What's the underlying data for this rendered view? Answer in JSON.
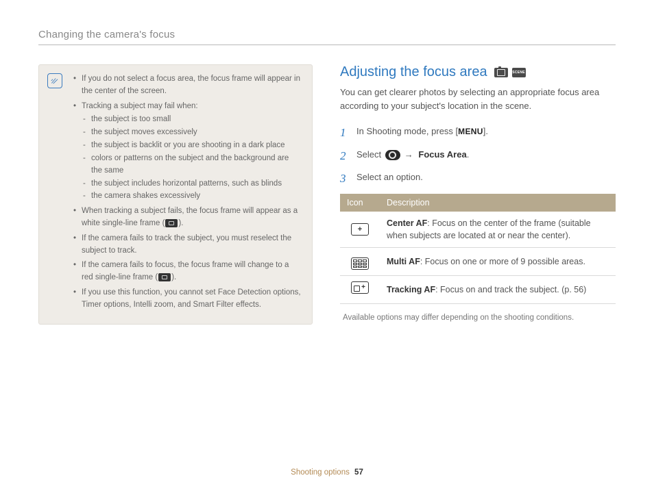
{
  "header": {
    "title": "Changing the camera's focus"
  },
  "notebox": {
    "items": [
      {
        "text": "If you do not select a focus area, the focus frame will appear in the center of the screen."
      },
      {
        "text": "Tracking a subject may fail when:",
        "sub": [
          "the subject is too small",
          "the subject moves excessively",
          "the subject is backlit or you are shooting in a dark place",
          "colors or patterns on the subject and the background are the same",
          "the subject includes horizontal patterns, such as blinds",
          "the camera shakes excessively"
        ]
      },
      {
        "text_pre": "When tracking a subject fails, the focus frame will appear as a white single-line frame (",
        "text_post": ").",
        "frame": "white"
      },
      {
        "text": "If the camera fails to track the subject, you must reselect the subject to track."
      },
      {
        "text_pre": "If the camera fails to focus, the focus frame will change to a red single-line frame (",
        "text_post": ").",
        "frame": "red"
      },
      {
        "text": "If you use this function, you cannot set Face Detection options, Timer options, Intelli zoom, and Smart Filter effects."
      }
    ]
  },
  "section": {
    "title": "Adjusting the focus area",
    "intro": "You can get clearer photos by selecting an appropriate focus area according to your subject's location in the scene.",
    "steps": {
      "s1_pre": "In Shooting mode, press [",
      "s1_menu": "MENU",
      "s1_post": "].",
      "s2_pre": "Select ",
      "s2_arrow": "→",
      "s2_label": "Focus Area",
      "s2_post": ".",
      "s3": "Select an option."
    },
    "table": {
      "h1": "Icon",
      "h2": "Description",
      "rows": [
        {
          "b": "Center AF",
          "t": ": Focus on the center of the frame (suitable when subjects are located at or near the center)."
        },
        {
          "b": "Multi AF",
          "t": ": Focus on one or more of 9 possible areas."
        },
        {
          "b": "Tracking AF",
          "t": ": Focus on and track the subject. (p. 56)"
        }
      ]
    },
    "footnote": "Available options may differ depending on the shooting conditions."
  },
  "footer": {
    "chapter": "Shooting options",
    "page": "57"
  }
}
